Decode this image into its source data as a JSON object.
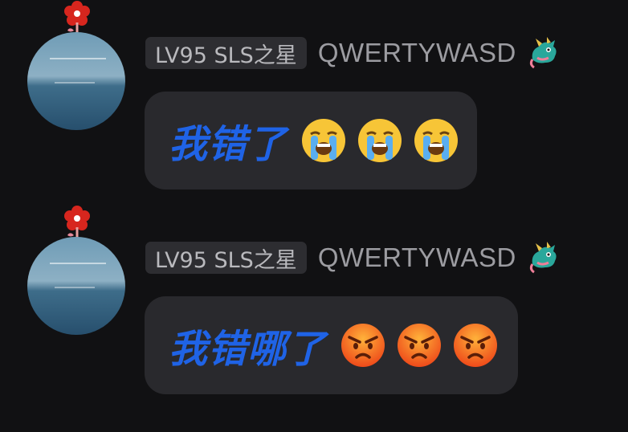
{
  "messages": [
    {
      "level_badge": "LV95 SLS之星",
      "username": "QWERTYWASD",
      "text": "我错了",
      "emojis": [
        "loudly-crying-face",
        "loudly-crying-face",
        "loudly-crying-face"
      ]
    },
    {
      "level_badge": "LV95 SLS之星",
      "username": "QWERTYWASD",
      "text": "我错哪了",
      "emojis": [
        "angry-face",
        "angry-face",
        "angry-face"
      ]
    }
  ],
  "colors": {
    "background": "#111113",
    "bubble": "#29292d",
    "message_text": "#1f63e6",
    "username": "#9c9ca1",
    "badge_bg": "#2d2d31"
  }
}
